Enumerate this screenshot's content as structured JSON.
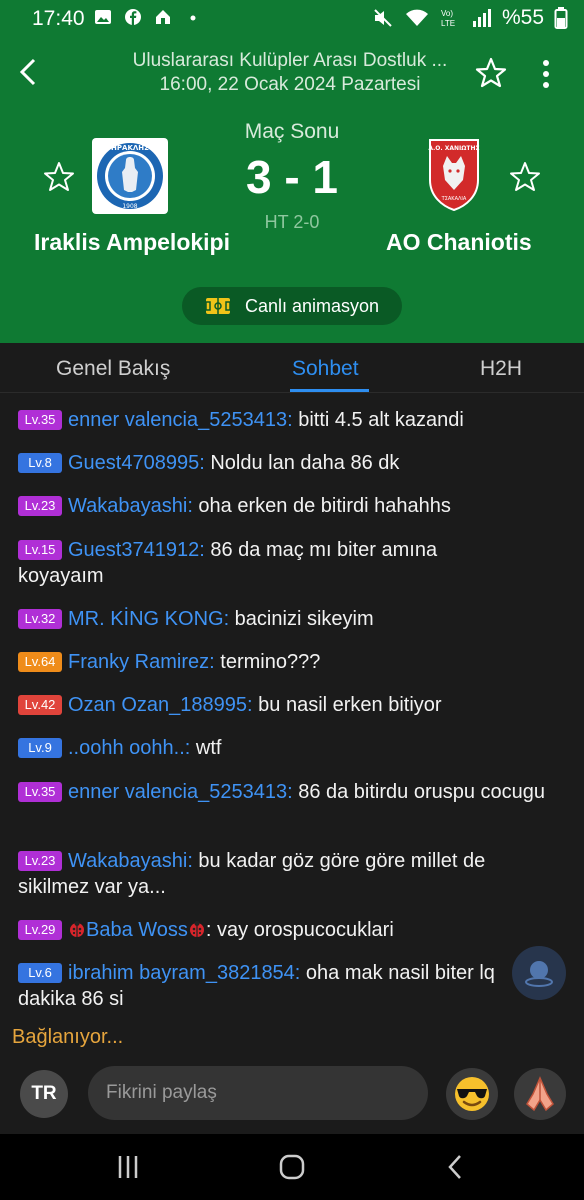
{
  "status_bar": {
    "time": "17:40",
    "battery": "%55",
    "icons": [
      "image-icon",
      "facebook-icon",
      "home-lock-icon",
      "dot-icon",
      "mute-icon",
      "wifi-icon",
      "lte-icon",
      "signal-icon",
      "battery-icon"
    ]
  },
  "header": {
    "competition": "Uluslararası Kulüpler Arası Dostluk ...",
    "datetime": "16:00, 22 Ocak 2024 Pazartesi",
    "accent_color": "#0f7a33"
  },
  "match": {
    "status": "Maç Sonu",
    "score": "3 - 1",
    "halftime": "HT 2-0",
    "home_team": "Iraklis Ampelokipi",
    "away_team": "AO Chaniotis",
    "home_logo_text": "ΗΡΑΚΛΗΣ",
    "home_logo_year": "1908",
    "away_logo_text": "Α.Ο. ΧΑΝΙΩΤΗΣ",
    "away_logo_sub": "ΤΣΑΚΑΛΙΑ"
  },
  "live_button": {
    "label": "Canlı animasyon"
  },
  "tabs": [
    {
      "label": "Genel Bakış"
    },
    {
      "label": "Sohbet",
      "active": true
    },
    {
      "label": "H2H"
    }
  ],
  "chat": [
    {
      "level": "Lv.35",
      "color": "purple",
      "user": "enner valencia_5253413:",
      "text": " bitti 4.5 alt kazandi"
    },
    {
      "level": "Lv.8",
      "color": "blue",
      "user": "Guest4708995:",
      "text": " Noldu lan daha 86 dk"
    },
    {
      "level": "Lv.23",
      "color": "purple",
      "user": "Wakabayashi:",
      "text": " oha erken de bitirdi hahahhs"
    },
    {
      "level": "Lv.15",
      "color": "purple",
      "user": "Guest3741912:",
      "text": " 86 da maç mı biter amına koyayaım"
    },
    {
      "level": "Lv.32",
      "color": "purple",
      "user": "MR. KİNG KONG:",
      "text": " bacinizi sikeyim"
    },
    {
      "level": "Lv.64",
      "color": "orange",
      "user": "Franky Ramirez:",
      "text": " termino???"
    },
    {
      "level": "Lv.42",
      "color": "red",
      "user": "Ozan Ozan_188995:",
      "text": " bu nasil erken bitiyor"
    },
    {
      "level": "Lv.9",
      "color": "blue",
      "user": "..oohh oohh..:",
      "text": " wtf"
    },
    {
      "level": "Lv.35",
      "color": "purple",
      "user": "enner valencia_5253413:",
      "text": " 86 da bitirdu oruspu cocugu"
    },
    {
      "level": "Lv.23",
      "color": "purple",
      "user": "Wakabayashi:",
      "text": " bu kadar göz göre göre millet de sikilmez var ya..."
    },
    {
      "level": "Lv.29",
      "color": "purple",
      "user": "Baba Woss",
      "text": ": vay orospucocuklari"
    },
    {
      "level": "Lv.6",
      "color": "blue",
      "user": "ibrahim bayram_3821854:",
      "text": " oha mak nasil biter lq dakika 86 si"
    }
  ],
  "connecting_text": "Bağlanıyor...",
  "composer": {
    "lang": "TR",
    "placeholder": "Fikrini paylaş"
  }
}
